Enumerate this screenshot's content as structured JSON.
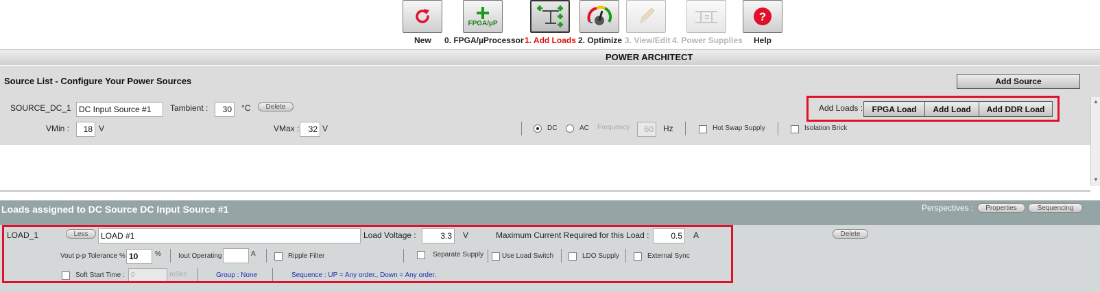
{
  "toolbar": {
    "items": [
      {
        "label": "New",
        "icon": "refresh-icon"
      },
      {
        "label": "0. FPGA/µProcessor",
        "icon_text": "FPGA/µP",
        "icon": "fpga-plus-icon"
      },
      {
        "label": "1. Add Loads",
        "icon": "add-loads-icon"
      },
      {
        "label": "2. Optimize",
        "icon": "gauge-icon"
      },
      {
        "label": "3. View/Edit",
        "icon": "pencil-icon"
      },
      {
        "label": "4. Power Supplies",
        "icon": "circuit-icon"
      },
      {
        "label": "Help",
        "icon": "help-icon"
      }
    ]
  },
  "app_title": "POWER ARCHITECT",
  "source_list": {
    "title": "Source List - Configure Your Power Sources",
    "add_source_label": "Add Source",
    "source_id": "SOURCE_DC_1",
    "source_name": "DC Input Source #1",
    "tambient_label": "Tambient :",
    "tambient_value": "30",
    "tambient_unit": "°C",
    "delete_label": "Delete",
    "vmin_label": "VMin :",
    "vmin_value": "18",
    "vmin_unit": "V",
    "vmax_label": "VMax :",
    "vmax_value": "32",
    "vmax_unit": "V",
    "dc_label": "DC",
    "ac_label": "AC",
    "frequency_label": "Frequency",
    "frequency_value": "60",
    "frequency_unit": "Hz",
    "hot_swap_label": "Hot Swap Supply",
    "isolation_label": "Isolation Brick",
    "add_loads_label": "Add Loads :",
    "fpga_load_label": "FPGA Load",
    "add_load_label": "Add Load",
    "add_ddr_load_label": "Add DDR Load"
  },
  "loads": {
    "title": "Loads assigned to DC Source DC Input Source #1",
    "perspectives_label": "Perspectives :",
    "properties_label": "Properties",
    "sequencing_label": "Sequencing",
    "load_id": "LOAD_1",
    "less_label": "Less",
    "load_name": "LOAD #1",
    "load_voltage_label": "Load Voltage :",
    "load_voltage_value": "3.3",
    "load_voltage_unit": "V",
    "max_current_label": "Maximum Current Required for this Load :",
    "max_current_value": "0.5",
    "max_current_unit": "A",
    "delete_label": "Delete",
    "vout_tol_label": "Vout p-p Tolerance %",
    "vout_tol_value": "10",
    "vout_tol_unit": "%",
    "iout_label": "Iout Operating",
    "iout_value": "",
    "iout_unit": "A",
    "ripple_label": "Ripple Filter",
    "separate_label": "Separate Supply",
    "load_switch_label": "Use Load Switch",
    "ldo_label": "LDO Supply",
    "ext_sync_label": "External Sync",
    "soft_start_label": "Soft Start Time :",
    "soft_start_value": "0",
    "soft_start_unit": "mSec",
    "group_text": "Group : None",
    "sequence_text": "Sequence : UP = Any order., Down = Any order."
  },
  "colors": {
    "active_step": "#e01010",
    "disabled_step": "#b5b5b5",
    "highlight": "#e0102a",
    "loads_header": "#95a5a6"
  }
}
